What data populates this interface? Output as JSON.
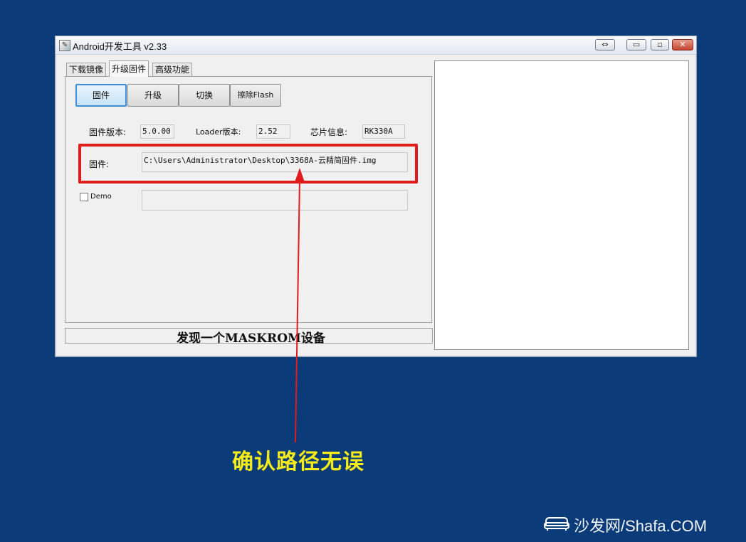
{
  "window": {
    "title": "Android开发工具 v2.33",
    "controls": {
      "restore_glyph": "⇔",
      "minimize_glyph": "▭",
      "maximize_glyph": "▫",
      "close_glyph": "✕"
    }
  },
  "tabs": [
    {
      "label": "下载镜像",
      "active": false
    },
    {
      "label": "升级固件",
      "active": true
    },
    {
      "label": "高级功能",
      "active": false
    }
  ],
  "toolbar": {
    "firmware_label": "固件",
    "upgrade_label": "升级",
    "switch_label": "切换",
    "erase_label": "擦除Flash"
  },
  "info": {
    "fw_version_label": "固件版本:",
    "fw_version_value": "5.0.00",
    "loader_version_label": "Loader版本:",
    "loader_version_value": "2.52",
    "chip_label": "芯片信息:",
    "chip_value": "RK330A"
  },
  "firmware": {
    "label": "固件:",
    "path": "C:\\Users\\Administrator\\Desktop\\3368A-云精简固件.img"
  },
  "demo": {
    "label": "Demo",
    "checked": false
  },
  "status": {
    "text": "发现一个MASKROM设备"
  },
  "annotation": {
    "text": "确认路径无误",
    "color": "#f6ec1a",
    "arrow_color": "#e01b1b"
  },
  "watermark": {
    "text": "沙发网/Shafa.COM"
  },
  "colors": {
    "background": "#0b3b78",
    "highlight_frame": "#e01b1b",
    "selected_button": "#3c8ed8"
  }
}
